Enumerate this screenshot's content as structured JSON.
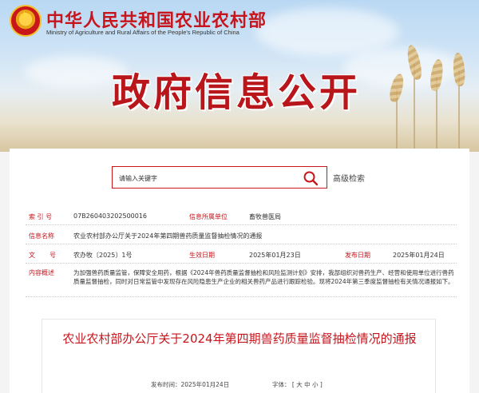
{
  "header": {
    "ministry_cn": "中华人民共和国农业农村部",
    "ministry_en": "Ministry of Agriculture and Rural Affairs of the People's Republic of China",
    "hero_title": "政府信息公开"
  },
  "search": {
    "placeholder": "请输入关键字",
    "advanced_label": "高级检索"
  },
  "meta": {
    "index_label": "索 引 号",
    "index_value": "07B260403202500016",
    "org_label": "信息所属单位",
    "org_value": "畜牧兽医局",
    "title_label": "信息名称",
    "title_value": "农业农村部办公厅关于2024年第四期兽药质量监督抽检情况的通报",
    "docno_label_a": "文",
    "docno_label_b": "号",
    "docno_value": "农办牧〔2025〕1号",
    "effective_label": "生效日期",
    "effective_value": "2025年01月23日",
    "publish_label": "发布日期",
    "publish_value": "2025年01月24日",
    "summary_label": "内容概述",
    "summary_value": "为加强兽药质量监管，保障安全用药，根据《2024年兽药质量监督抽检和风险监测计划》安排，我部组织对兽药生产、经营和使用单位进行兽药质量监督抽检，同时对日常监管中发现存在风险隐患生产企业的相关兽药产品进行跟踪检验。现将2024年第三季度监督抽检有关情况通报如下。"
  },
  "article": {
    "title": "农业农村部办公厅关于2024年第四期兽药质量监督抽检情况的通报",
    "date_text": "发布时间：2025年01月24日",
    "font_label": "字体：",
    "font_open": "[",
    "font_large": "大",
    "font_medium": "中",
    "font_small": "小",
    "font_close": "]"
  },
  "colors": {
    "brand_red": "#c6151c",
    "search_border": "#c9161a"
  },
  "icons": [
    "national-emblem-icon",
    "search-icon"
  ]
}
